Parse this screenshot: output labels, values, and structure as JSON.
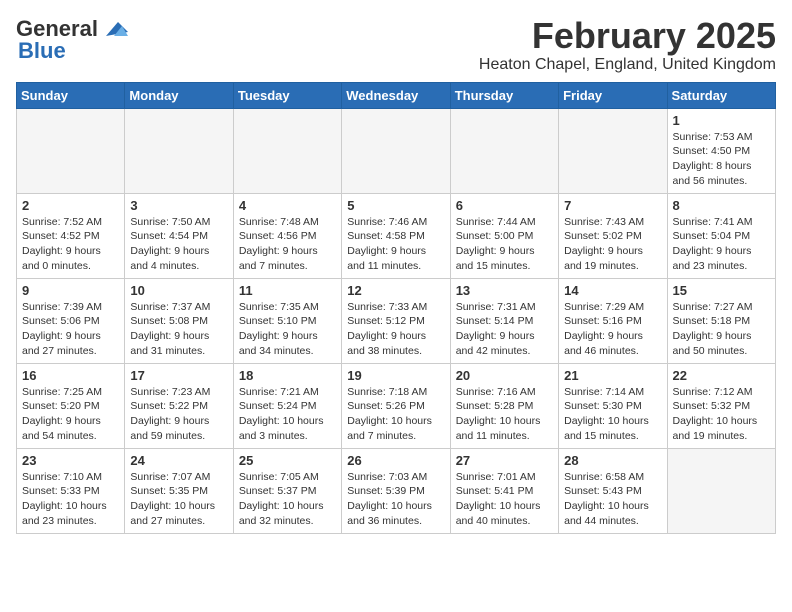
{
  "header": {
    "logo_general": "General",
    "logo_blue": "Blue",
    "title": "February 2025",
    "subtitle": "Heaton Chapel, England, United Kingdom"
  },
  "days_of_week": [
    "Sunday",
    "Monday",
    "Tuesday",
    "Wednesday",
    "Thursday",
    "Friday",
    "Saturday"
  ],
  "weeks": [
    [
      {
        "day": "",
        "info": ""
      },
      {
        "day": "",
        "info": ""
      },
      {
        "day": "",
        "info": ""
      },
      {
        "day": "",
        "info": ""
      },
      {
        "day": "",
        "info": ""
      },
      {
        "day": "",
        "info": ""
      },
      {
        "day": "1",
        "info": "Sunrise: 7:53 AM\nSunset: 4:50 PM\nDaylight: 8 hours and 56 minutes."
      }
    ],
    [
      {
        "day": "2",
        "info": "Sunrise: 7:52 AM\nSunset: 4:52 PM\nDaylight: 9 hours and 0 minutes."
      },
      {
        "day": "3",
        "info": "Sunrise: 7:50 AM\nSunset: 4:54 PM\nDaylight: 9 hours and 4 minutes."
      },
      {
        "day": "4",
        "info": "Sunrise: 7:48 AM\nSunset: 4:56 PM\nDaylight: 9 hours and 7 minutes."
      },
      {
        "day": "5",
        "info": "Sunrise: 7:46 AM\nSunset: 4:58 PM\nDaylight: 9 hours and 11 minutes."
      },
      {
        "day": "6",
        "info": "Sunrise: 7:44 AM\nSunset: 5:00 PM\nDaylight: 9 hours and 15 minutes."
      },
      {
        "day": "7",
        "info": "Sunrise: 7:43 AM\nSunset: 5:02 PM\nDaylight: 9 hours and 19 minutes."
      },
      {
        "day": "8",
        "info": "Sunrise: 7:41 AM\nSunset: 5:04 PM\nDaylight: 9 hours and 23 minutes."
      }
    ],
    [
      {
        "day": "9",
        "info": "Sunrise: 7:39 AM\nSunset: 5:06 PM\nDaylight: 9 hours and 27 minutes."
      },
      {
        "day": "10",
        "info": "Sunrise: 7:37 AM\nSunset: 5:08 PM\nDaylight: 9 hours and 31 minutes."
      },
      {
        "day": "11",
        "info": "Sunrise: 7:35 AM\nSunset: 5:10 PM\nDaylight: 9 hours and 34 minutes."
      },
      {
        "day": "12",
        "info": "Sunrise: 7:33 AM\nSunset: 5:12 PM\nDaylight: 9 hours and 38 minutes."
      },
      {
        "day": "13",
        "info": "Sunrise: 7:31 AM\nSunset: 5:14 PM\nDaylight: 9 hours and 42 minutes."
      },
      {
        "day": "14",
        "info": "Sunrise: 7:29 AM\nSunset: 5:16 PM\nDaylight: 9 hours and 46 minutes."
      },
      {
        "day": "15",
        "info": "Sunrise: 7:27 AM\nSunset: 5:18 PM\nDaylight: 9 hours and 50 minutes."
      }
    ],
    [
      {
        "day": "16",
        "info": "Sunrise: 7:25 AM\nSunset: 5:20 PM\nDaylight: 9 hours and 54 minutes."
      },
      {
        "day": "17",
        "info": "Sunrise: 7:23 AM\nSunset: 5:22 PM\nDaylight: 9 hours and 59 minutes."
      },
      {
        "day": "18",
        "info": "Sunrise: 7:21 AM\nSunset: 5:24 PM\nDaylight: 10 hours and 3 minutes."
      },
      {
        "day": "19",
        "info": "Sunrise: 7:18 AM\nSunset: 5:26 PM\nDaylight: 10 hours and 7 minutes."
      },
      {
        "day": "20",
        "info": "Sunrise: 7:16 AM\nSunset: 5:28 PM\nDaylight: 10 hours and 11 minutes."
      },
      {
        "day": "21",
        "info": "Sunrise: 7:14 AM\nSunset: 5:30 PM\nDaylight: 10 hours and 15 minutes."
      },
      {
        "day": "22",
        "info": "Sunrise: 7:12 AM\nSunset: 5:32 PM\nDaylight: 10 hours and 19 minutes."
      }
    ],
    [
      {
        "day": "23",
        "info": "Sunrise: 7:10 AM\nSunset: 5:33 PM\nDaylight: 10 hours and 23 minutes."
      },
      {
        "day": "24",
        "info": "Sunrise: 7:07 AM\nSunset: 5:35 PM\nDaylight: 10 hours and 27 minutes."
      },
      {
        "day": "25",
        "info": "Sunrise: 7:05 AM\nSunset: 5:37 PM\nDaylight: 10 hours and 32 minutes."
      },
      {
        "day": "26",
        "info": "Sunrise: 7:03 AM\nSunset: 5:39 PM\nDaylight: 10 hours and 36 minutes."
      },
      {
        "day": "27",
        "info": "Sunrise: 7:01 AM\nSunset: 5:41 PM\nDaylight: 10 hours and 40 minutes."
      },
      {
        "day": "28",
        "info": "Sunrise: 6:58 AM\nSunset: 5:43 PM\nDaylight: 10 hours and 44 minutes."
      },
      {
        "day": "",
        "info": ""
      }
    ]
  ]
}
